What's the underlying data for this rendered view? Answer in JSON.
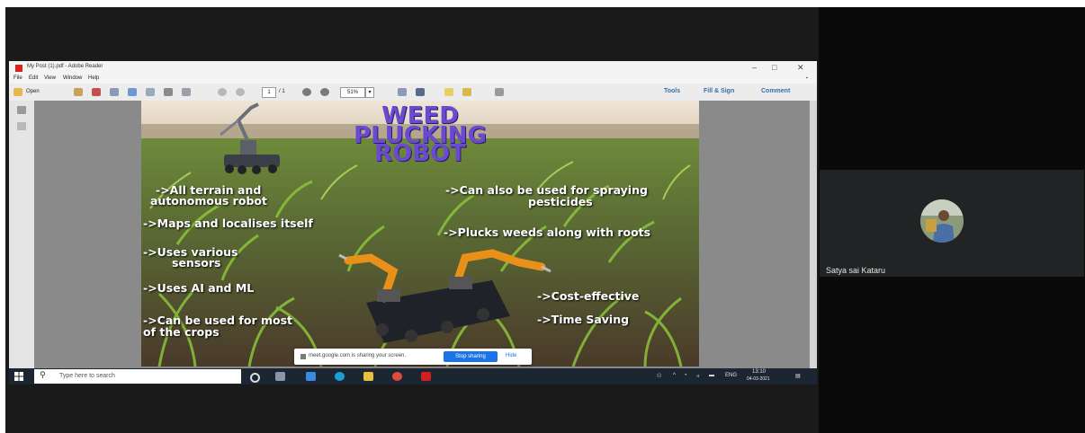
{
  "viewer": {
    "window_title": "My Post (1).pdf - Adobe Reader",
    "menu": [
      "File",
      "Edit",
      "View",
      "Window",
      "Help"
    ],
    "toolbar": {
      "open_label": "Open",
      "page_current": "1",
      "page_total": "/ 1",
      "zoom": "51%",
      "tools_label": "Tools",
      "fill_sign_label": "Fill & Sign",
      "comment_label": "Comment"
    }
  },
  "poster": {
    "title_lines": [
      "WEED",
      "PLUCKING",
      "ROBOT"
    ],
    "left_points": [
      "->All terrain and",
      "autonomous robot",
      "->Maps and localises itself",
      "->Uses various",
      "sensors",
      "->Uses AI and ML",
      "->Can be used for most",
      "of the crops"
    ],
    "right_points": [
      "->Can also be used for spraying",
      "pesticides",
      "->Plucks weeds along with roots",
      "->Cost-effective",
      "->Time Saving"
    ]
  },
  "share_banner": {
    "message": "meet.google.com is sharing your screen.",
    "stop_label": "Stop sharing",
    "hide_label": "Hide"
  },
  "taskbar": {
    "search_placeholder": "Type here to search",
    "lang": "ENG",
    "time": "13:10",
    "date": "04-03-2021"
  },
  "participant": {
    "name": "Satya sai Kataru"
  },
  "colors": {
    "title_purple": "#6a4bd0",
    "stop_blue": "#1a73e8",
    "taskbar": "#1c2633"
  }
}
